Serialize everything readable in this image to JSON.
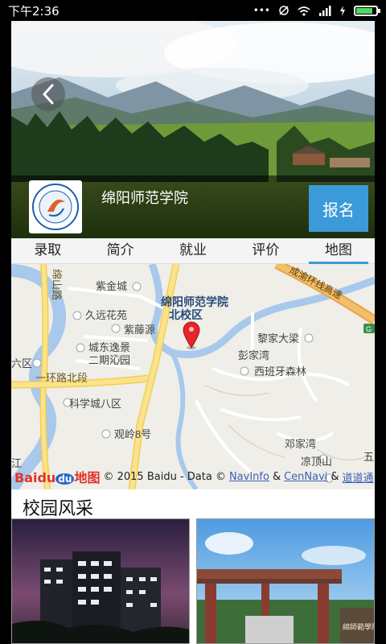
{
  "status_bar": {
    "time": "下午2:36",
    "icons": [
      "more-dots-icon",
      "mute-icon",
      "wifi-icon",
      "signal-icon",
      "charging-icon",
      "battery-icon"
    ],
    "battery_level": 0.85,
    "battery_color": "#4cd964"
  },
  "header": {
    "back_icon": "chevron-left-icon",
    "school_name": "绵阳师范学院",
    "signup_label": "报名",
    "accent": "#3b9ad8"
  },
  "tabs": [
    {
      "label": "录取",
      "active": false
    },
    {
      "label": "简介",
      "active": false
    },
    {
      "label": "就业",
      "active": false
    },
    {
      "label": "评价",
      "active": false
    },
    {
      "label": "地图",
      "active": true
    }
  ],
  "map": {
    "labels": {
      "campus": "绵阳师范学院北校区",
      "zijincheng": "紫金城",
      "jiuyuan": "久远花苑",
      "zitengyuan": "紫藤源",
      "chengdong": "城东逸景",
      "erqi": "二期沁园",
      "yihuan": "一环路北段",
      "kexuecheng": "科学城八区",
      "guanling": "观岭8号",
      "lijia": "黎家大梁",
      "pengjiawan": "彭家湾",
      "xibanya": "西班牙森林",
      "dengjiawan": "邓家湾",
      "liangdingshan": "凉顶山",
      "mianshan_road": "绵山路",
      "expressway": "成渝环线高速",
      "liu_qu": "六区",
      "jiang": "江",
      "wu": "五",
      "g": "G"
    },
    "attribution": {
      "logo": "Baidu",
      "logo_du": "du",
      "logo_cn": "地图",
      "text": "© 2015 Baidu - Data ©",
      "link1": "NavInfo",
      "amp1": "&",
      "link2": "CenNavi",
      "amp2": "&",
      "link3": "道道通"
    }
  },
  "campus_section": {
    "title": "校园风采"
  }
}
